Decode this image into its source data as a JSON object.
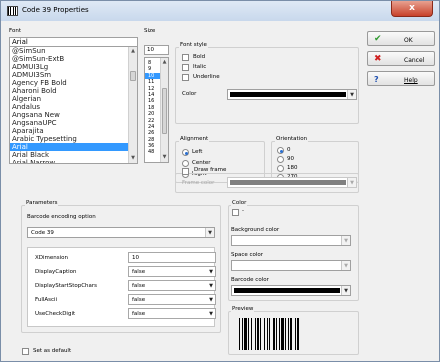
{
  "window": {
    "title": "Code 39 Properties",
    "close_glyph": "x"
  },
  "font_section": {
    "font_label": "Font",
    "font_value": "Arial",
    "fonts": [
      "@SimSun",
      "@SimSun-ExtB",
      "ADMUI3Lg",
      "ADMUI3Sm",
      "Agency FB Bold",
      "Aharoni Bold",
      "Algerian",
      "Andalus",
      "Angsana New",
      "AngsanaUPC",
      "Aparajita",
      "Arabic Typesetting",
      "Arial",
      "Arial Black",
      "Arial Narrow"
    ],
    "selected_font": "Arial",
    "size_label": "Size",
    "size_value": "10",
    "sizes": [
      "8",
      "9",
      "10",
      "11",
      "12",
      "14",
      "16",
      "18",
      "20",
      "22",
      "24",
      "26",
      "28",
      "36",
      "48"
    ],
    "selected_size": "10"
  },
  "font_style": {
    "label": "Font style",
    "bold": "Bold",
    "italic": "Italic",
    "underline": "Underline",
    "color_label": "Color",
    "color_value": "#000000"
  },
  "alignment": {
    "label": "Alignment",
    "options": [
      "Left",
      "Center",
      "Right"
    ],
    "selected": "Left"
  },
  "orientation": {
    "label": "Orientation",
    "options": [
      "0",
      "90",
      "180",
      "270"
    ],
    "selected": "0"
  },
  "frame": {
    "draw_frame_label": "Draw frame",
    "frame_color_label": "Frame color",
    "frame_color_value": "#808080"
  },
  "parameters": {
    "label": "Parameters",
    "encoding_label": "Barcode encoding option",
    "encoding_value": "Code 39",
    "rows": [
      {
        "name": "XDimension",
        "value": "10",
        "has_dropdown": false
      },
      {
        "name": "DisplayCaption",
        "value": "false",
        "has_dropdown": true
      },
      {
        "name": "DisplayStartStopChars",
        "value": "false",
        "has_dropdown": true
      },
      {
        "name": "FullAscii",
        "value": "false",
        "has_dropdown": true
      },
      {
        "name": "UseCheckDigit",
        "value": "false",
        "has_dropdown": true
      }
    ]
  },
  "color_section": {
    "label": "Color",
    "dash": "-",
    "background_label": "Background color",
    "space_label": "Space color",
    "barcode_label": "Barcode color",
    "barcode_color_value": "#000000"
  },
  "preview": {
    "label": "Preview"
  },
  "set_default": {
    "label": "Set as default"
  },
  "buttons": {
    "ok": "OK",
    "cancel": "Cancel",
    "help": "Help"
  },
  "colors": {
    "selection": "#3399ff",
    "ok_icon": "#2e9a2e",
    "cancel_icon": "#d02020",
    "help_icon": "#2050b0"
  }
}
